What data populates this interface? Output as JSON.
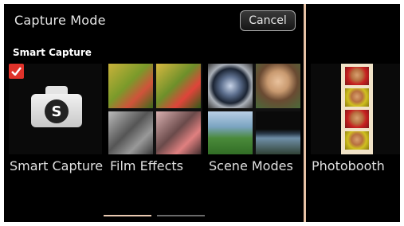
{
  "header": {
    "title": "Capture Mode",
    "cancel_label": "Cancel"
  },
  "section_label": "Smart Capture",
  "modes": [
    {
      "label": "Smart Capture",
      "selected": true
    },
    {
      "label": "Film Effects"
    },
    {
      "label": "Scene Modes"
    },
    {
      "label": "Photobooth"
    }
  ],
  "pager": {
    "pages": 2,
    "current": 1
  },
  "colors": {
    "accent": "#e0322a",
    "divider": "#e8c3a6"
  }
}
